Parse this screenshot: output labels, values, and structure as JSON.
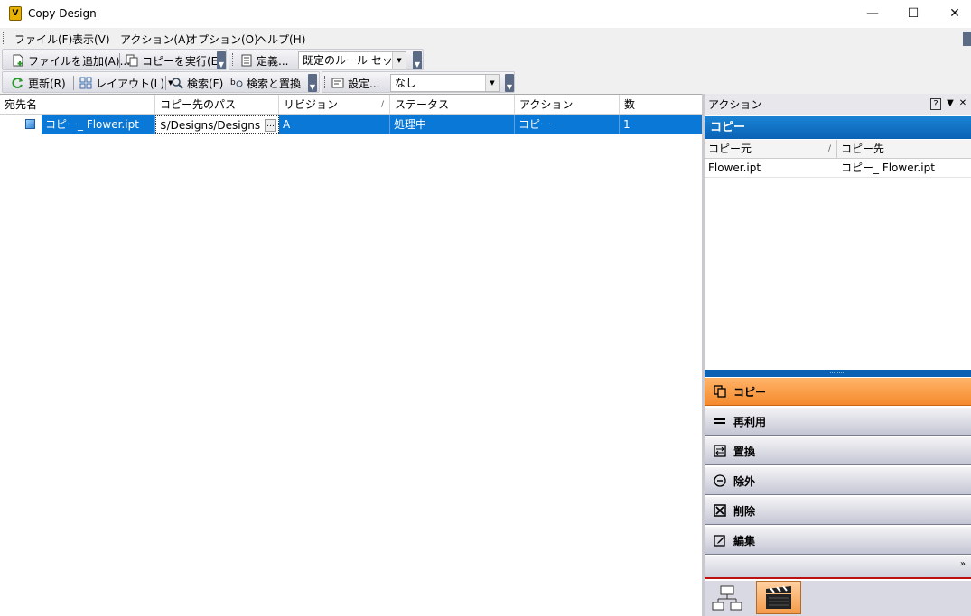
{
  "window": {
    "title": "Copy Design",
    "app_icon_glyph": "V"
  },
  "menu": [
    "ファイル(F)",
    "表示(V)",
    "アクション(A)",
    "オプション(O)",
    "ヘルプ(H)"
  ],
  "toolbar1": {
    "add_files": "ファイルを追加(A)...",
    "run_copy": "コピーを実行(E)",
    "define": "定義...",
    "ruleset_value": "既定のルール セット"
  },
  "toolbar2": {
    "refresh": "更新(R)",
    "layout": "レイアウト(L)",
    "search": "検索(F)",
    "search_replace": "検索と置換",
    "settings": "設定...",
    "filter_value": "なし"
  },
  "grid": {
    "columns": [
      "宛先名",
      "コピー先のパス",
      "リビジョン",
      "ステータス",
      "アクション",
      "数"
    ],
    "rows": [
      {
        "name": "コピー_ Flower.ipt",
        "path": "$/Designs/Designs",
        "revision": "A",
        "status": "処理中",
        "action": "コピー",
        "count": "1"
      }
    ]
  },
  "panel": {
    "title": "アクション",
    "header": "コピー",
    "columns": [
      "コピー元",
      "コピー先"
    ],
    "rows": [
      {
        "source": "Flower.ipt",
        "dest": "コピー_ Flower.ipt"
      }
    ],
    "actions": [
      {
        "label": "コピー",
        "icon": "copy-icon",
        "active": true
      },
      {
        "label": "再利用",
        "icon": "reuse-icon",
        "active": false
      },
      {
        "label": "置換",
        "icon": "replace-icon",
        "active": false
      },
      {
        "label": "除外",
        "icon": "exclude-icon",
        "active": false
      },
      {
        "label": "削除",
        "icon": "delete-icon",
        "active": false
      },
      {
        "label": "編集",
        "icon": "edit-icon",
        "active": false
      }
    ]
  },
  "colors": {
    "selection": "#0a78d7",
    "active_action": "#f58a2c",
    "panel_header": "#0b62b5"
  }
}
